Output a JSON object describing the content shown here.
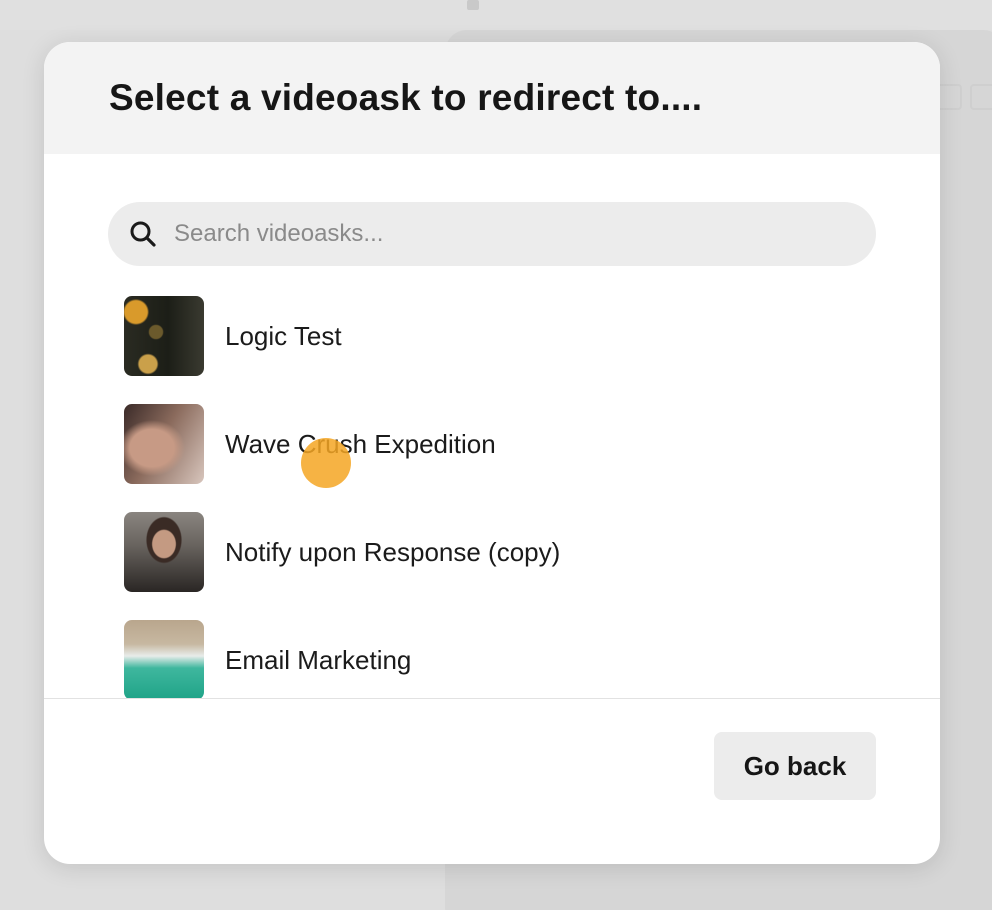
{
  "modal": {
    "title": "Select a videoask to redirect to....",
    "search": {
      "placeholder": "Search videoasks...",
      "value": ""
    },
    "items": [
      {
        "label": "Logic Test"
      },
      {
        "label": "Wave Crush Expedition"
      },
      {
        "label": "Notify upon Response (copy)"
      },
      {
        "label": "Email Marketing"
      }
    ],
    "go_back_label": "Go back"
  },
  "colors": {
    "cursor_highlight": "#F5A623",
    "header_bg": "#F3F3F3",
    "button_bg": "#ECECEC"
  }
}
